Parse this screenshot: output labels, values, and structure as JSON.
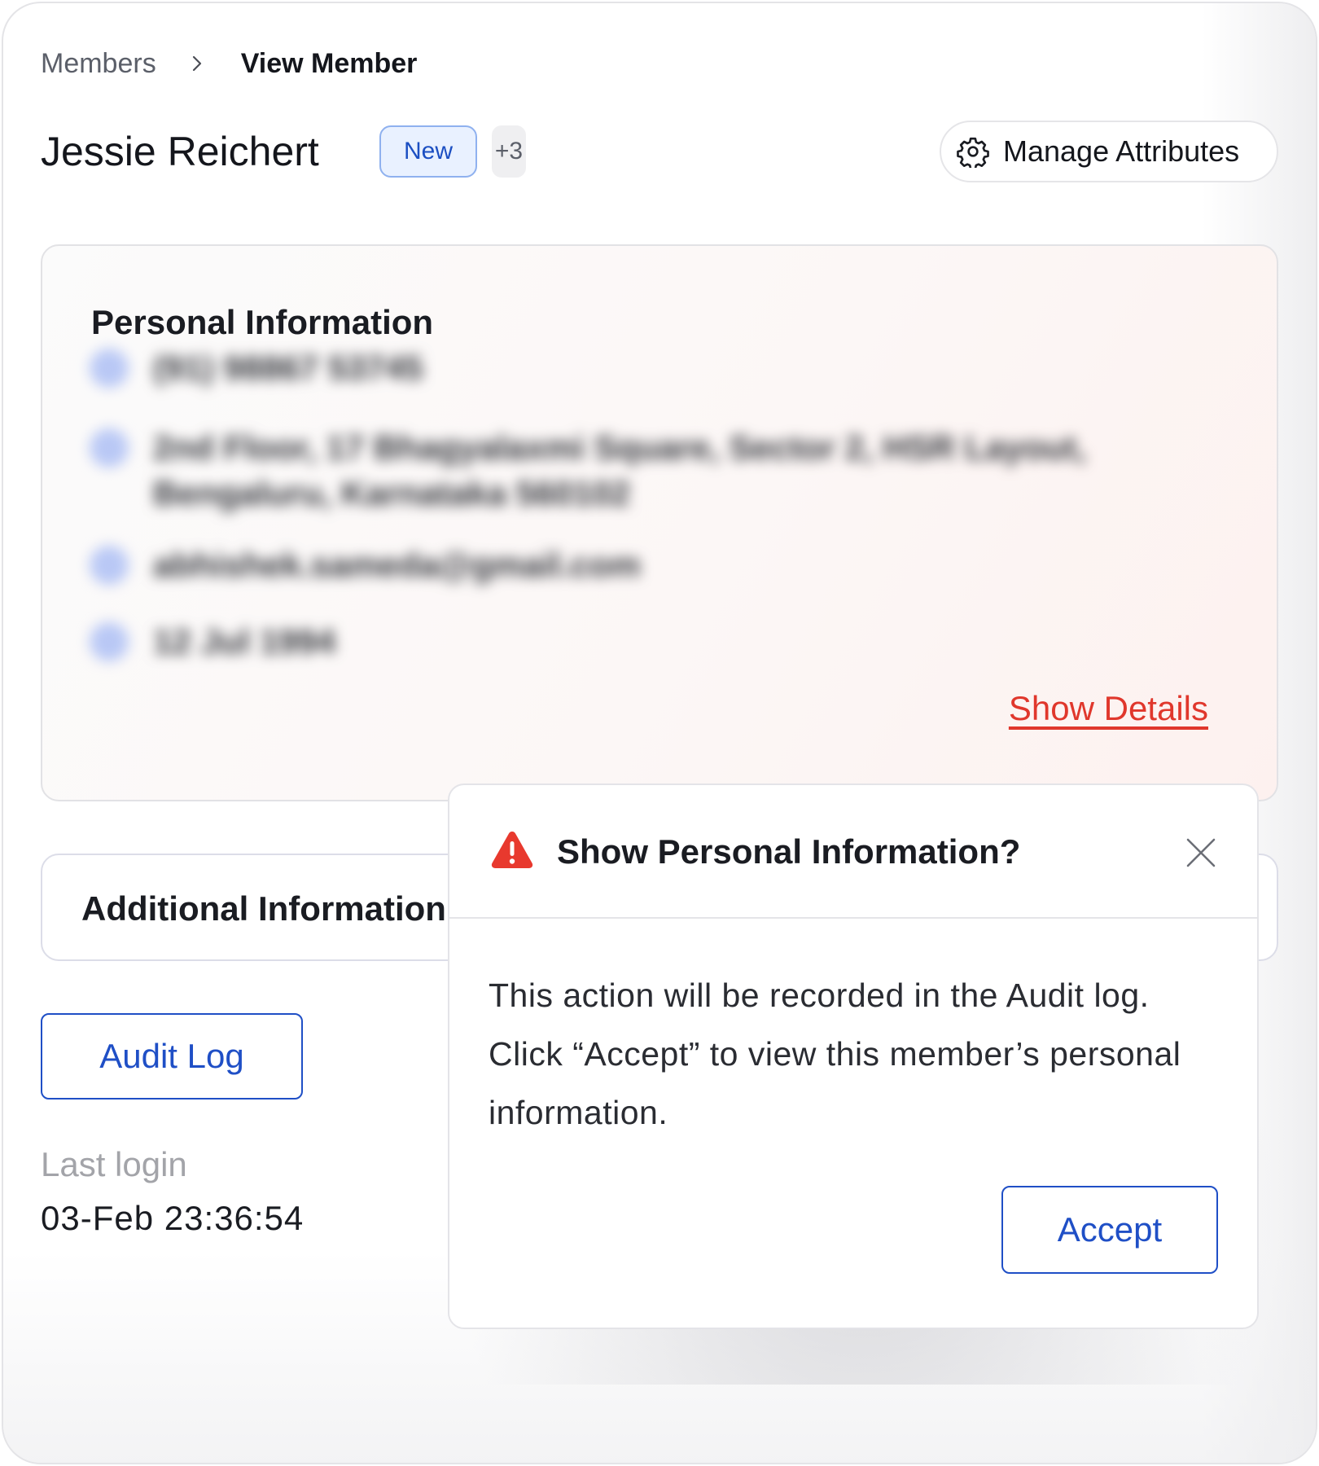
{
  "breadcrumb": {
    "parent": "Members",
    "current": "View Member"
  },
  "member": {
    "name": "Jessie Reichert",
    "tag": "New",
    "more_tags": "+3"
  },
  "toolbar": {
    "manage_attributes_label": "Manage Attributes",
    "manage_attributes_icon": "gear-icon"
  },
  "personal_info": {
    "title": "Personal Information",
    "redacted_rows": [
      {
        "icon": "phone-icon",
        "text": "(91) 98867 53745"
      },
      {
        "icon": "location-icon",
        "text": "2nd Floor, 17 Bhagyalaxmi Square, Sector 2, HSR Layout, Bengaluru, Karnataka 560102"
      },
      {
        "icon": "mail-icon",
        "text": "abhishek.sameda@gmail.com"
      },
      {
        "icon": "calendar-icon",
        "text": "12 Jul 1994"
      }
    ],
    "show_details_label": "Show Details"
  },
  "additional_info": {
    "title": "Additional Information"
  },
  "audit_log_label": "Audit Log",
  "last_login": {
    "label": "Last login",
    "value": "03-Feb 23:36:54"
  },
  "modal": {
    "title": "Show Personal Information?",
    "icon": "warning-icon",
    "body": "This action will be recorded in the Audit log. Click “Accept” to view this member’s personal information.",
    "accept_label": "Accept"
  },
  "colors": {
    "accent_blue": "#1f4fc6",
    "danger_red": "#e0372c",
    "badge_bg": "#e9f1ff"
  }
}
